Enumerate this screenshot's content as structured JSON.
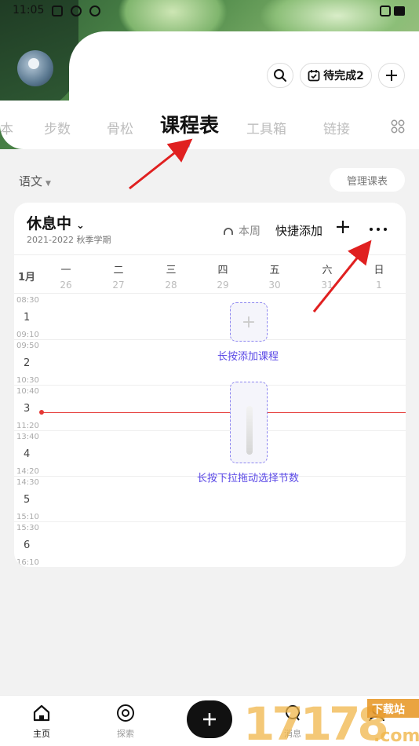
{
  "status": {
    "time": "11:05"
  },
  "header": {
    "pending_label": "待完成2"
  },
  "tabs": [
    "本",
    "步数",
    "骨松",
    "课程表",
    "工具箱",
    "链接"
  ],
  "subject": {
    "label": "语文"
  },
  "manage_label": "管理课表",
  "schedule": {
    "title": "休息中",
    "term": "2021-2022 秋季学期",
    "week_label": "本周",
    "quick_add_label": "快捷添加",
    "month": "1月",
    "days": [
      {
        "wd": "一",
        "dt": "26"
      },
      {
        "wd": "二",
        "dt": "27"
      },
      {
        "wd": "三",
        "dt": "28"
      },
      {
        "wd": "四",
        "dt": "29"
      },
      {
        "wd": "五",
        "dt": "30"
      },
      {
        "wd": "六",
        "dt": "31"
      },
      {
        "wd": "日",
        "dt": "1"
      }
    ],
    "periods": [
      {
        "start": "08:30",
        "n": "1",
        "end": "09:10"
      },
      {
        "start": "09:50",
        "n": "2",
        "end": "10:30"
      },
      {
        "start": "10:40",
        "n": "3",
        "end": "11:20"
      },
      {
        "start": "13:40",
        "n": "4",
        "end": "14:20"
      },
      {
        "start": "14:30",
        "n": "5",
        "end": "15:10"
      },
      {
        "start": "15:30",
        "n": "6",
        "end": "16:10"
      }
    ],
    "hint_add": "长按添加课程",
    "hint_drag": "长按下拉拖动选择节数"
  },
  "nav": {
    "home": "主页",
    "explore": "探索",
    "messages": "消息",
    "profile": ""
  },
  "watermark": "17178下载站 .com",
  "colors": {
    "accent": "#5a48e6",
    "now_line": "#e53935",
    "arrow": "#e02020"
  }
}
